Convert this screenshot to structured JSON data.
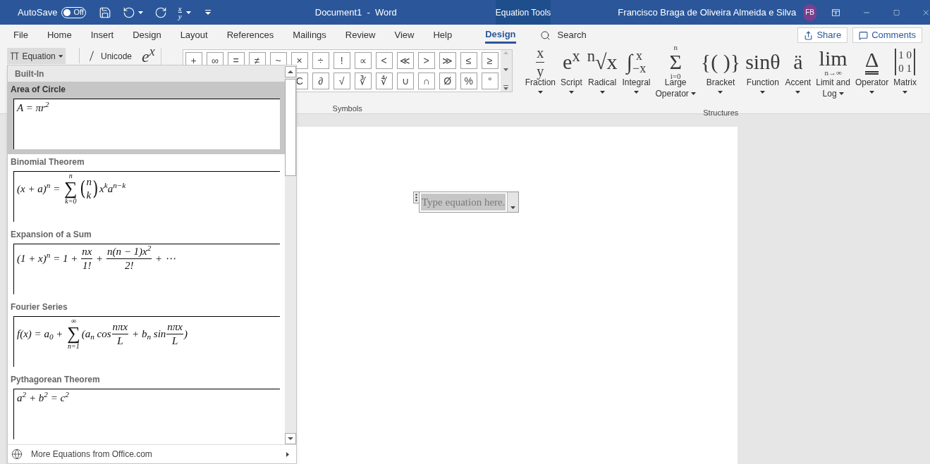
{
  "title_bar": {
    "autosave_label": "AutoSave",
    "autosave_state": "Off",
    "autosave_on": false,
    "document_title": "Document1  -  Word",
    "context_tab": "Equation Tools",
    "user_name": "Francisco Braga de Oliveira Almeida e Silva",
    "user_initials": "FB"
  },
  "quick_access": [
    {
      "kind": "save",
      "menu": false
    },
    {
      "kind": "undo",
      "menu": true
    },
    {
      "kind": "redo",
      "menu": false
    },
    {
      "kind": "fraction",
      "num": "x",
      "den": "y",
      "menu": true
    },
    {
      "kind": "customize"
    }
  ],
  "menu": {
    "tabs": [
      {
        "label": "File",
        "selected": false
      },
      {
        "label": "Home",
        "selected": false
      },
      {
        "label": "Insert",
        "selected": false
      },
      {
        "label": "Design",
        "selected": false
      },
      {
        "label": "Layout",
        "selected": false
      },
      {
        "label": "References",
        "selected": false
      },
      {
        "label": "Mailings",
        "selected": false
      },
      {
        "label": "Review",
        "selected": false
      },
      {
        "label": "View",
        "selected": false
      },
      {
        "label": "Help",
        "selected": false
      },
      {
        "label": "Design",
        "selected": true
      }
    ],
    "search": "Search",
    "share": "Share",
    "comments": "Comments"
  },
  "ribbon": {
    "equation": "Equation",
    "unicode": "Unicode",
    "script_preview": "e$^{x}$",
    "symbols": {
      "label": "Symbols",
      "rows": [
        [
          "+",
          "∞",
          "=",
          "≠",
          "~",
          "×",
          "÷",
          "!",
          "∝",
          "<",
          "≪",
          ">",
          "≫",
          "≤",
          "≥"
        ],
        [
          "",
          "",
          "",
          "",
          "",
          "C",
          "∂",
          "√",
          "∛",
          "∜",
          "∪",
          "∩",
          "Ø",
          "%",
          "°"
        ]
      ]
    },
    "structures": {
      "label": "Structures",
      "items": [
        {
          "label": "Fraction",
          "glyph": [
            {
              "kind": "frac",
              "num": "x",
              "den": "y"
            }
          ]
        },
        {
          "label": "Script",
          "glyph": [
            {
              "kind": "text",
              "text": "e$^{x}$"
            }
          ]
        },
        {
          "label": "Radical",
          "glyph": [
            {
              "kind": "text",
              "text": "$^{n}$√x"
            }
          ]
        },
        {
          "label": "Integral",
          "glyph": [
            {
              "kind": "op_side",
              "sym": "∫",
              "over": "x",
              "under": "−x"
            }
          ]
        },
        {
          "label": "Large Operator",
          "glyph": [
            {
              "kind": "op",
              "sym": "Σ",
              "over": "n",
              "under": "i=0"
            }
          ]
        },
        {
          "label": "Bracket",
          "glyph": [
            {
              "kind": "text",
              "text": "{( )}"
            }
          ]
        },
        {
          "label": "Function",
          "glyph": [
            {
              "kind": "text",
              "text": "sinθ"
            }
          ]
        },
        {
          "label": "Accent",
          "glyph": [
            {
              "kind": "text",
              "text": "ä"
            }
          ]
        },
        {
          "label": "Limit and Log",
          "glyph": [
            {
              "kind": "op",
              "sym": "lim",
              "under": "n→∞"
            }
          ]
        },
        {
          "label": "Operator",
          "glyph": [
            {
              "kind": "underlined",
              "text": "Δ"
            }
          ]
        },
        {
          "label": "Matrix",
          "glyph": [
            {
              "kind": "matrix",
              "rows": [
                "1 0",
                "0 1"
              ]
            }
          ]
        }
      ]
    }
  },
  "equation_gallery": {
    "header": "Built-In",
    "footer": "More Equations from Office.com",
    "items": [
      {
        "title": "Area of Circle",
        "selected": true,
        "parts": [
          {
            "kind": "text",
            "text": "A = πr$^{2}$"
          }
        ]
      },
      {
        "title": "Binomial Theorem",
        "selected": false,
        "parts": [
          {
            "kind": "text",
            "text": "(x + a)$^{n}$ = "
          },
          {
            "kind": "op",
            "sym": "∑",
            "over": "n",
            "under": "k=0"
          },
          {
            "kind": "binom",
            "open": "(",
            "top": "n",
            "bottom": "k",
            "close": ")"
          },
          {
            "kind": "text",
            "text": "x$^{k}$a$^{n−k}$"
          }
        ]
      },
      {
        "title": "Expansion of a Sum",
        "selected": false,
        "parts": [
          {
            "kind": "text",
            "text": "(1 + x)$^{n}$ = 1 + "
          },
          {
            "kind": "frac",
            "num": "nx",
            "den": "1!"
          },
          {
            "kind": "text",
            "text": " + "
          },
          {
            "kind": "frac",
            "num": "n(n − 1)x$^{2}$",
            "den": "2!"
          },
          {
            "kind": "text",
            "text": " + ⋯"
          }
        ]
      },
      {
        "title": "Fourier Series",
        "selected": false,
        "parts": [
          {
            "kind": "text",
            "text": "f(x) = a$_{0}$ + "
          },
          {
            "kind": "op",
            "sym": "∑",
            "over": "∞",
            "under": "n=1"
          },
          {
            "kind": "text",
            "text": "(a$_{n}$ cos"
          },
          {
            "kind": "frac",
            "num": "nπx",
            "den": "L"
          },
          {
            "kind": "text",
            "text": " + b$_{n}$ sin"
          },
          {
            "kind": "frac",
            "num": "nπx",
            "den": "L"
          },
          {
            "kind": "text",
            "text": ")"
          }
        ]
      },
      {
        "title": "Pythagorean Theorem",
        "selected": false,
        "parts": [
          {
            "kind": "text",
            "text": "a$^{2}$ + b$^{2}$ = c$^{2}$"
          }
        ]
      }
    ]
  },
  "document": {
    "placeholder": "Type equation here."
  }
}
